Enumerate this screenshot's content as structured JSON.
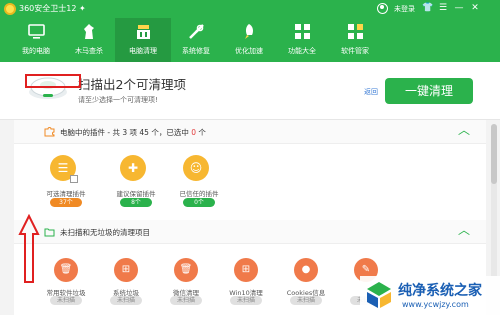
{
  "app": {
    "title": "360安全卫士12 ✦",
    "user_status": "未登录"
  },
  "nav": [
    {
      "label": "我的电脑",
      "icon": "computer-icon"
    },
    {
      "label": "木马查杀",
      "icon": "horse-icon"
    },
    {
      "label": "电脑清理",
      "icon": "broom-icon",
      "active": true
    },
    {
      "label": "系统修复",
      "icon": "wrench-icon"
    },
    {
      "label": "优化加速",
      "icon": "rocket-icon"
    },
    {
      "label": "功能大全",
      "icon": "grid-icon"
    },
    {
      "label": "软件管家",
      "icon": "apps-icon"
    }
  ],
  "scan": {
    "title": "扫描出2个可清理项",
    "subtitle": "请至少选择一个可清理项!",
    "return_label": "返回",
    "clean_button": "一键清理"
  },
  "plugins": {
    "header_prefix": "电脑中的插件 - 共 3 项 45 个，已选中",
    "selected_count": "0",
    "header_suffix": "个",
    "cards": [
      {
        "label": "可选清理插件",
        "count": "37个",
        "pill": "orange",
        "glyph": "list-icon"
      },
      {
        "label": "建议保留插件",
        "count": "8个",
        "pill": "green",
        "glyph": "puzzle-icon"
      },
      {
        "label": "已信任的插件",
        "count": "0个",
        "pill": "green",
        "glyph": "smile-icon"
      }
    ]
  },
  "unscanned": {
    "header": "未扫描和无垃圾的清理项目",
    "items": [
      {
        "label": "常用软件垃圾",
        "status": "未扫描",
        "glyph": "trash-icon"
      },
      {
        "label": "系统垃圾",
        "status": "未扫描",
        "glyph": "windows-icon"
      },
      {
        "label": "微信清理",
        "status": "未扫描",
        "glyph": "trash-icon"
      },
      {
        "label": "Win10清理",
        "status": "未扫描",
        "glyph": "windows-icon"
      },
      {
        "label": "Cookies信息",
        "status": "未扫描",
        "glyph": "cookie-icon"
      },
      {
        "label": "",
        "status": "未扫描",
        "glyph": "pin-icon"
      }
    ]
  },
  "watermark": {
    "main": "纯净系统之家",
    "url": "www.ycwjzy.com"
  },
  "colors": {
    "primary": "#2bb24c",
    "orange": "#f7b731",
    "accent_red": "#e02020"
  }
}
